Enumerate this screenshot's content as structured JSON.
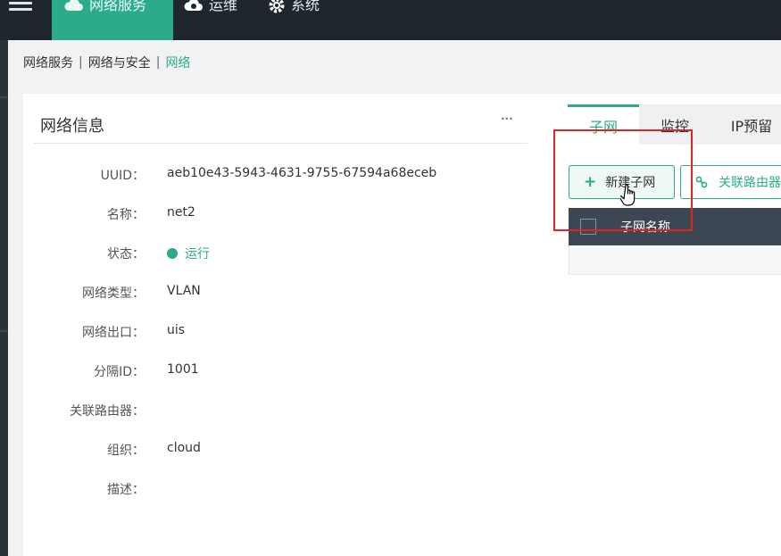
{
  "nav": {
    "items": [
      {
        "label": "网络服务",
        "icon": "cloud-icon",
        "active": true
      },
      {
        "label": "运维",
        "icon": "cloud-gear-icon",
        "active": false
      },
      {
        "label": "系统",
        "icon": "gear-icon",
        "active": false
      }
    ]
  },
  "breadcrumb": {
    "items": [
      "网络服务",
      "网络与安全"
    ],
    "current": "网络",
    "separator": "|"
  },
  "panel": {
    "title": "网络信息",
    "more": "···",
    "fields": [
      {
        "label": "UUID：",
        "value": "aeb10e43-5943-4631-9755-67594a68eceb"
      },
      {
        "label": "名称：",
        "value": "net2"
      },
      {
        "label": "状态：",
        "value": "运行"
      },
      {
        "label": "网络类型：",
        "value": "VLAN"
      },
      {
        "label": "网络出口：",
        "value": "uis"
      },
      {
        "label": "分隔ID：",
        "value": "1001"
      },
      {
        "label": "关联路由器：",
        "value": ""
      },
      {
        "label": "组织：",
        "value": "cloud"
      },
      {
        "label": "描述：",
        "value": ""
      }
    ]
  },
  "tabs": [
    {
      "label": "子网",
      "active": true
    },
    {
      "label": "监控",
      "active": false
    },
    {
      "label": "IP预留",
      "active": false
    }
  ],
  "toolbar": {
    "new_subnet": "新建子网",
    "link_router": "关联路由器"
  },
  "table": {
    "columns": [
      "子网名称"
    ]
  },
  "colors": {
    "accent": "#2bab8a",
    "topbar": "#1f272e",
    "highlight": "#e02424",
    "table_header": "#3c4753"
  }
}
